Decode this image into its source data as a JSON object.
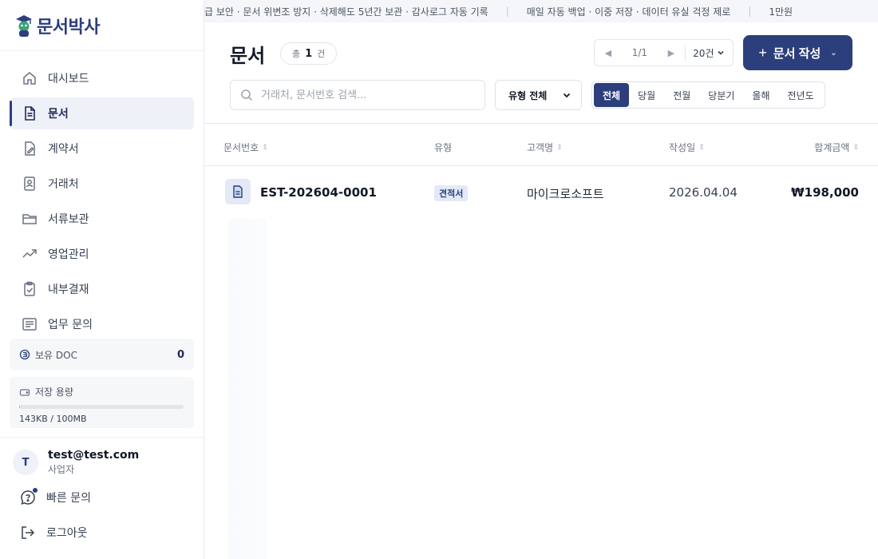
{
  "app": {
    "logo_text": "문서박사"
  },
  "sidebar": {
    "items": [
      {
        "label": "대시보드",
        "icon": "home-icon",
        "active": false
      },
      {
        "label": "문서",
        "icon": "document-icon",
        "active": true
      },
      {
        "label": "계약서",
        "icon": "contract-icon",
        "active": false
      },
      {
        "label": "거래처",
        "icon": "contact-icon",
        "active": false
      },
      {
        "label": "서류보관",
        "icon": "folder-icon",
        "active": false
      },
      {
        "label": "영업관리",
        "icon": "trend-icon",
        "active": false
      },
      {
        "label": "내부결재",
        "icon": "clipboard-check-icon",
        "active": false
      },
      {
        "label": "업무 문의",
        "icon": "message-icon",
        "active": false
      }
    ],
    "doc_balance": {
      "label": "보유 DOC",
      "value": "0"
    },
    "storage": {
      "label": "저장 용량",
      "text": "143KB / 100MB",
      "fraction": 0.0014
    },
    "user": {
      "initial": "T",
      "email": "test@test.com",
      "role": "사업자"
    },
    "quick_inquiry": "빠른 문의",
    "logout": "로그아웃"
  },
  "ticker": {
    "items": [
      "급 보안 · 문서 위변조 방지 · 삭제해도 5년간 보관 · 감사로그 자동 기록",
      "매일 자동 백업 · 이중 저장 · 데이터 유실 걱정 제로",
      "1만원"
    ],
    "separator": "|"
  },
  "main": {
    "title": "문서",
    "count": {
      "prefix": "총",
      "value": "1",
      "suffix": "건"
    },
    "pager": {
      "page": "1/1",
      "page_size": "20건"
    },
    "create_button": "문서 작성",
    "search_placeholder": "거래처, 문서번호 검색...",
    "type_filter": "유형 전체",
    "periods": [
      {
        "label": "전체",
        "active": true
      },
      {
        "label": "당월",
        "active": false
      },
      {
        "label": "전월",
        "active": false
      },
      {
        "label": "당분기",
        "active": false
      },
      {
        "label": "올해",
        "active": false
      },
      {
        "label": "전년도",
        "active": false
      }
    ],
    "columns": {
      "doc_no": "문서번호",
      "type": "유형",
      "customer": "고객명",
      "date": "작성일",
      "amount": "합계금액"
    },
    "rows": [
      {
        "doc_no": "EST-202604-0001",
        "type": "견적서",
        "customer": "마이크로소프트",
        "date": "2026.04.04",
        "amount": "₩198,000"
      }
    ]
  },
  "colors": {
    "brand": "#2c3e7b",
    "active_bg": "#eef1f8",
    "badge_bg": "#e3eaf7"
  }
}
